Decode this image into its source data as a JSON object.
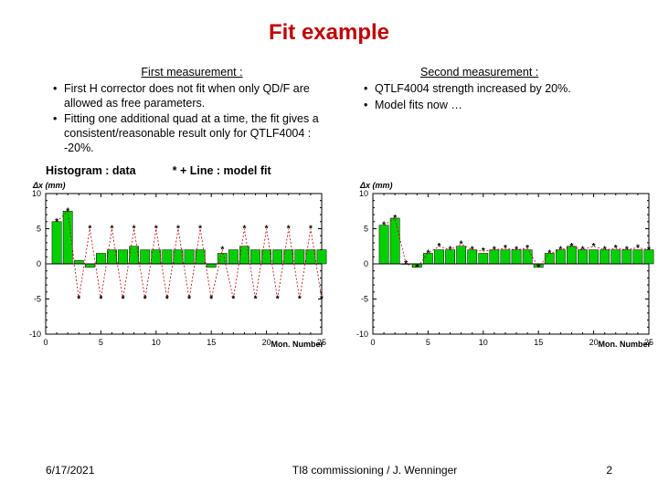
{
  "title": "Fit example",
  "left": {
    "heading": "First measurement :",
    "bullets": [
      "First H corrector does not fit when only QD/F are allowed as free parameters.",
      "Fitting one additional quad at a time, the fit gives a consistent/reasonable result only for QTLF4004 : -20%."
    ]
  },
  "right": {
    "heading": "Second measurement :",
    "bullets": [
      "QTLF4004 strength increased by 20%.",
      "Model fits now …"
    ]
  },
  "legend": {
    "data": "Histogram : data",
    "model": "* + Line : model fit"
  },
  "footer": {
    "date": "6/17/2021",
    "middle": "TI8 commissioning / J. Wenninger",
    "page": "2"
  },
  "chart_data": [
    {
      "type": "bar",
      "title": "",
      "xlabel": "Mon. Number",
      "ylabel": "Δx (mm)",
      "ylim": [
        -10,
        10
      ],
      "xlim": [
        0,
        25
      ],
      "yticks": [
        -10,
        -5,
        0,
        5,
        10
      ],
      "xticks": [
        0,
        5,
        10,
        15,
        20,
        25
      ],
      "categories": [
        1,
        2,
        3,
        4,
        5,
        6,
        7,
        8,
        9,
        10,
        11,
        12,
        13,
        14,
        15,
        16,
        17,
        18,
        19,
        20,
        21,
        22,
        23,
        24,
        25
      ],
      "series": [
        {
          "name": "data",
          "values": [
            6.0,
            7.5,
            0.5,
            -0.5,
            1.5,
            2.0,
            2.0,
            2.5,
            2.0,
            2.0,
            2.0,
            2.0,
            2.0,
            2.0,
            -0.5,
            1.5,
            2.0,
            2.5,
            2.0,
            2.0,
            2.0,
            2.0,
            2.0,
            2.0,
            2.0
          ]
        },
        {
          "name": "model",
          "values": [
            6.0,
            7.5,
            -5.0,
            5.0,
            -5.0,
            5.0,
            -5.0,
            5.0,
            -5.0,
            5.0,
            -5.0,
            5.0,
            -5.0,
            5.0,
            -5.0,
            2.0,
            -5.0,
            5.0,
            -5.0,
            5.0,
            -5.0,
            5.0,
            -5.0,
            5.0,
            -5.0
          ]
        }
      ]
    },
    {
      "type": "bar",
      "title": "",
      "xlabel": "Mon. Number",
      "ylabel": "Δx (mm)",
      "ylim": [
        -10,
        10
      ],
      "xlim": [
        0,
        25
      ],
      "yticks": [
        -10,
        -5,
        0,
        5,
        10
      ],
      "xticks": [
        0,
        5,
        10,
        15,
        20,
        25
      ],
      "categories": [
        1,
        2,
        3,
        4,
        5,
        6,
        7,
        8,
        9,
        10,
        11,
        12,
        13,
        14,
        15,
        16,
        17,
        18,
        19,
        20,
        21,
        22,
        23,
        24,
        25
      ],
      "series": [
        {
          "name": "data",
          "values": [
            5.5,
            6.5,
            0.0,
            -0.5,
            1.5,
            2.0,
            2.0,
            2.5,
            2.0,
            1.5,
            2.0,
            2.0,
            2.0,
            2.0,
            -0.5,
            1.5,
            2.0,
            2.5,
            2.0,
            2.0,
            2.0,
            2.0,
            2.0,
            2.0,
            2.0
          ]
        },
        {
          "name": "model",
          "values": [
            5.5,
            6.5,
            0.0,
            -0.5,
            1.5,
            2.5,
            2.0,
            2.8,
            2.0,
            1.8,
            2.0,
            2.2,
            2.0,
            2.2,
            -0.5,
            1.5,
            2.0,
            2.5,
            2.0,
            2.5,
            2.0,
            2.2,
            2.0,
            2.3,
            2.0
          ]
        }
      ]
    }
  ]
}
